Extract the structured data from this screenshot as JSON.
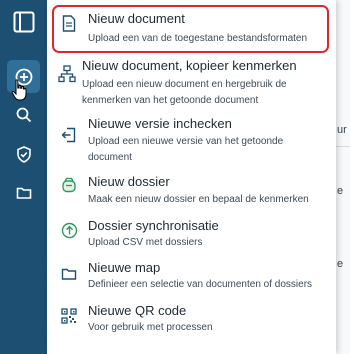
{
  "rail": {
    "items": [
      {
        "icon": "app-logo-icon"
      },
      {
        "icon": "plus-circle-icon",
        "active": true
      },
      {
        "icon": "search-icon"
      },
      {
        "icon": "shield-icon"
      },
      {
        "icon": "folder-icon"
      }
    ]
  },
  "menu": {
    "items": [
      {
        "title": "Nieuw document",
        "desc": "Upload een van de toegestane bestandsformaten",
        "icon": "document-icon",
        "highlighted": true
      },
      {
        "title": "Nieuw document, kopieer kenmerken",
        "desc": "Upload een nieuw document en hergebruik de kenmerken van het getoonde document",
        "icon": "hierarchy-icon"
      },
      {
        "title": "Nieuwe versie inchecken",
        "desc": "Upload een nieuwe versie van het getoonde document",
        "icon": "check-in-icon"
      },
      {
        "title": "Nieuw dossier",
        "desc": "Maak een nieuw dossier en bepaal de kenmerken",
        "icon": "dossier-icon"
      },
      {
        "title": "Dossier synchronisatie",
        "desc": "Upload CSV met dossiers",
        "icon": "upload-circle-icon"
      },
      {
        "title": "Nieuwe map",
        "desc": "Definieer een selectie van documenten of dossiers",
        "icon": "folder-icon"
      },
      {
        "title": "Nieuwe QR code",
        "desc": "Voor gebruik met processen",
        "icon": "qr-code-icon"
      }
    ]
  },
  "background": {
    "fragments": [
      "ur",
      "e",
      "e"
    ]
  },
  "colors": {
    "rail": "#1d4f73",
    "rail_active": "#2f6f98",
    "highlight_border": "#e0262e",
    "icon": "#1d4f73",
    "accent_green": "#2e9b5c"
  }
}
